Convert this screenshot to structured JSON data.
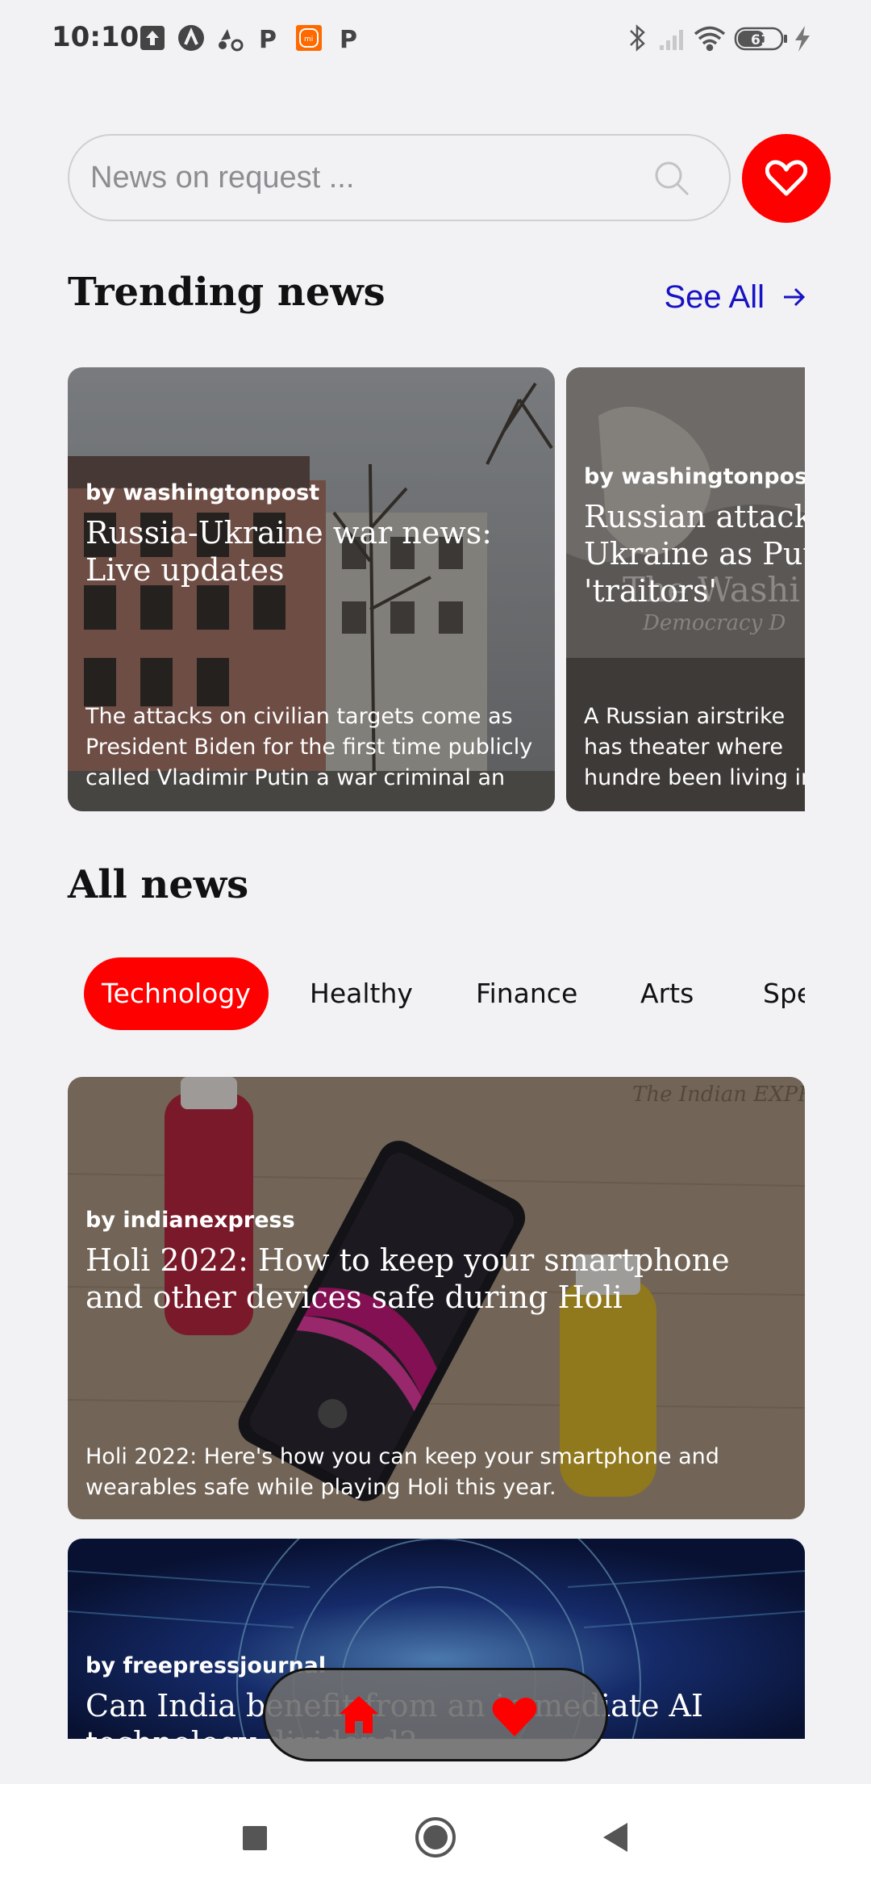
{
  "status_bar": {
    "time": "10:10",
    "battery": "61",
    "icons": [
      "upload-icon",
      "arrow-icon",
      "scooter-icon",
      "p-icon",
      "mi-icon",
      "p-icon",
      "bluetooth-icon",
      "signal-icon",
      "wifi-icon",
      "battery-icon",
      "charging-icon"
    ],
    "mi_label": "mi",
    "p_label": "P"
  },
  "search": {
    "placeholder": "News on request ..."
  },
  "trending": {
    "heading": "Trending news",
    "see_all_label": "See All",
    "cards": [
      {
        "source": "by washingtonpost",
        "title": "Russia-Ukraine war news: Live updates",
        "description": "The attacks on civilian targets come as President Biden for the first time publicly called Vladimir Putin a war criminal  an acc..."
      },
      {
        "source": "by washingtonpost",
        "title": "Russian attacks Ukraine as Putin 'traitors'",
        "description": "A Russian airstrike has theater where hundre been living in the besie"
      }
    ]
  },
  "all_news": {
    "heading": "All news",
    "categories": [
      "Technology",
      "Healthy",
      "Finance",
      "Arts",
      "Spe"
    ],
    "active_category": "Technology",
    "cards": [
      {
        "source": "by indianexpress",
        "title": "Holi 2022: How to keep your smartphone and other devices safe during Holi",
        "description": "Holi 2022: Here's how you can keep your smartphone and wearables safe while playing Holi this year."
      },
      {
        "source": "by freepressjournal",
        "title": "Can India benefit from an immediate AI technology dividend?"
      }
    ]
  },
  "colors": {
    "accent": "#ff0000",
    "link": "#1712c4",
    "background": "#f2f2f4"
  }
}
